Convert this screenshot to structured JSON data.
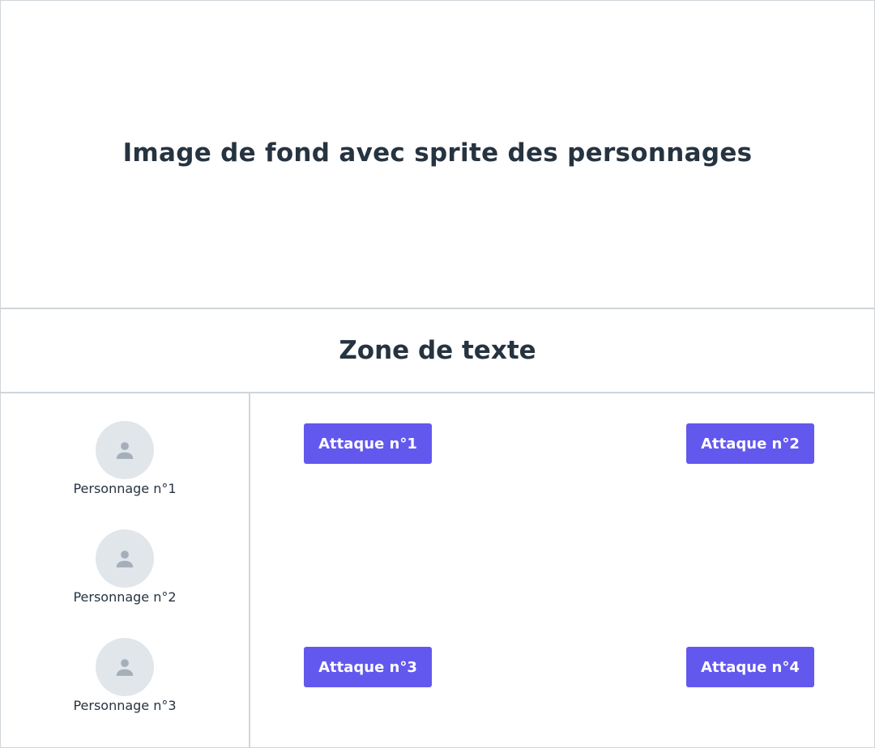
{
  "scene": {
    "title": "Image de fond avec sprite des personnages"
  },
  "text_zone": {
    "title": "Zone de texte"
  },
  "characters": [
    {
      "name": "Personnage n°1",
      "icon": "person-icon"
    },
    {
      "name": "Personnage n°2",
      "icon": "person-icon"
    },
    {
      "name": "Personnage n°3",
      "icon": "person-icon"
    }
  ],
  "attacks": [
    {
      "label": "Attaque n°1"
    },
    {
      "label": "Attaque n°2"
    },
    {
      "label": "Attaque n°3"
    },
    {
      "label": "Attaque n°4"
    }
  ],
  "colors": {
    "accent": "#6358ee",
    "text": "#263340",
    "border": "#cfd6da",
    "avatar_bg": "#e1e6eb",
    "avatar_icon": "#a4afb9"
  }
}
